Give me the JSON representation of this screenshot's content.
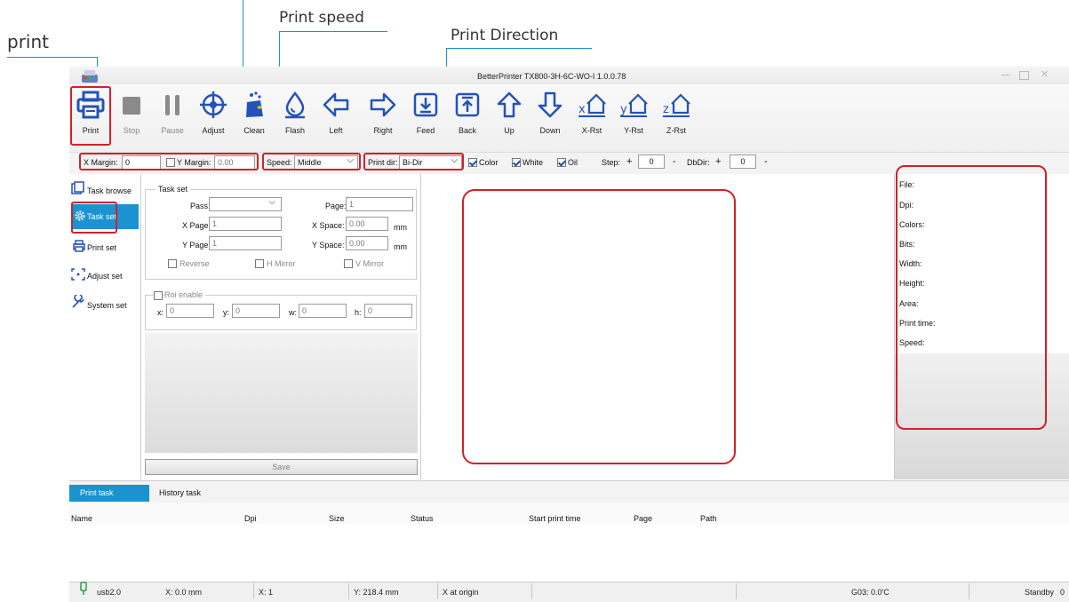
{
  "annotations": {
    "print": "print",
    "print_speed": "Print speed",
    "print_direction": "Print Direction"
  },
  "window": {
    "title": "BetterPrinter TX800-3H-6C-WO-I 1.0.0.78"
  },
  "toolbar": {
    "items": [
      {
        "label": "Print",
        "icon": "printer-icon"
      },
      {
        "label": "Stop",
        "icon": "stop-icon"
      },
      {
        "label": "Pause",
        "icon": "pause-icon"
      },
      {
        "label": "Adjust",
        "icon": "crosshair-icon"
      },
      {
        "label": "Clean",
        "icon": "clean-icon"
      },
      {
        "label": "Flash",
        "icon": "droplet-icon"
      },
      {
        "label": "Left",
        "icon": "arrow-left-icon"
      },
      {
        "label": "Right",
        "icon": "arrow-right-icon"
      },
      {
        "label": "Feed",
        "icon": "feed-icon"
      },
      {
        "label": "Back",
        "icon": "back-icon"
      },
      {
        "label": "Up",
        "icon": "arrow-up-icon"
      },
      {
        "label": "Down",
        "icon": "arrow-down-icon"
      },
      {
        "label": "X-Rst",
        "icon": "x-reset-icon"
      },
      {
        "label": "Y-Rst",
        "icon": "y-reset-icon"
      },
      {
        "label": "Z-Rst",
        "icon": "z-reset-icon"
      }
    ]
  },
  "settings_bar": {
    "x_margin_label": "X Margin:",
    "x_margin_value": "0",
    "y_margin_label": "Y Margin:",
    "y_margin_value": "0.00",
    "speed_label": "Speed:",
    "speed_value": "Middle",
    "print_dir_label": "Print dir:",
    "print_dir_value": "Bi-Dir",
    "color_label": "Color",
    "white_label": "White",
    "oil_label": "Oil",
    "step_label": "Step:",
    "step_value": "0",
    "dbdir_label": "DbDir:",
    "dbdir_value": "0",
    "plus": "+",
    "minus": "-"
  },
  "nav": {
    "items": [
      {
        "label": "Task browse"
      },
      {
        "label": "Task set"
      },
      {
        "label": "Print set"
      },
      {
        "label": "Adjust set"
      },
      {
        "label": "System set"
      }
    ]
  },
  "task_set": {
    "group_title": "Task set",
    "pass_label": "Pass:",
    "page_label": "Page:",
    "page_value": "1",
    "x_page_label": "X Page:",
    "x_page_value": "1",
    "x_space_label": "X Space:",
    "x_space_value": "0.00",
    "y_page_label": "Y Page:",
    "y_page_value": "1",
    "y_space_label": "Y Space:",
    "y_space_value": "0.00",
    "unit": "mm",
    "reverse_label": "Reverse",
    "h_mirror_label": "H Mirror",
    "v_mirror_label": "V Mirror",
    "roi_label": "Roi enable",
    "roi_x_label": "x:",
    "roi_x_value": "0",
    "roi_y_label": "y:",
    "roi_y_value": "0",
    "roi_w_label": "w:",
    "roi_w_value": "0",
    "roi_h_label": "h:",
    "roi_h_value": "0",
    "save_label": "Save"
  },
  "info_panel": {
    "file": "File:",
    "dpi": "Dpi:",
    "colors": "Colors:",
    "bits": "Bits:",
    "width": "Width:",
    "height": "Height:",
    "area": "Area:",
    "print_time": "Print time:",
    "speed": "Speed:"
  },
  "bottom_tabs": {
    "print_task": "Print task",
    "history_task": "History task"
  },
  "table": {
    "columns": [
      "Name",
      "Dpi",
      "Size",
      "Status",
      "Start print time",
      "Page",
      "Path"
    ]
  },
  "status_bar": {
    "connection": "usb2.0",
    "x_pos": "X: 0.0 mm",
    "x_count": "X: 1",
    "y_pos": "Y: 218.4 mm",
    "x_state": "X at origin",
    "temperature": "G03: 0.0'C",
    "state": "Standby",
    "count": "0"
  },
  "colors": {
    "accent": "#1b93d1",
    "highlight": "#d3202a",
    "icon": "#2452b8"
  }
}
